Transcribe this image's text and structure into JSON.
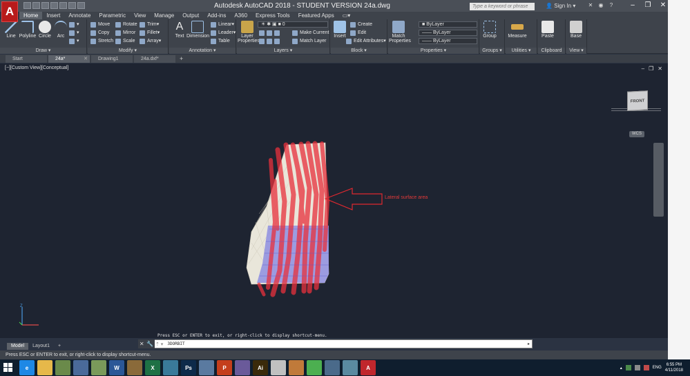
{
  "window": {
    "title": "Autodesk AutoCAD 2018 - STUDENT VERSION    24a.dwg",
    "search_placeholder": "Type a keyword or phrase",
    "signin": "Sign In",
    "logo": "A"
  },
  "ribbon_tabs": [
    "Home",
    "Insert",
    "Annotate",
    "Parametric",
    "View",
    "Manage",
    "Output",
    "Add-ins",
    "A360",
    "Express Tools",
    "Featured Apps"
  ],
  "ribbon": {
    "draw": {
      "title": "Draw",
      "line": "Line",
      "polyline": "Polyline",
      "circle": "Circle",
      "arc": "Arc"
    },
    "modify": {
      "title": "Modify",
      "move": "Move",
      "rotate": "Rotate",
      "trim": "Trim",
      "copy": "Copy",
      "mirror": "Mirror",
      "fillet": "Fillet",
      "stretch": "Stretch",
      "scale": "Scale",
      "array": "Array"
    },
    "annotation": {
      "title": "Annotation",
      "text": "Text",
      "dimension": "Dimension",
      "linear": "Linear",
      "leader": "Leader",
      "table": "Table"
    },
    "layers": {
      "title": "Layers",
      "layer_properties": "Layer Properties",
      "current_layer": "0",
      "make_current": "Make Current",
      "match_layer": "Match Layer"
    },
    "block": {
      "title": "Block",
      "insert": "Insert",
      "create": "Create",
      "edit": "Edit",
      "edit_attributes": "Edit Attributes"
    },
    "properties": {
      "title": "Properties",
      "match_properties": "Match Properties",
      "color": "ByLayer",
      "linetype": "ByLayer",
      "lineweight": "ByLayer"
    },
    "groups": {
      "title": "Groups",
      "group": "Group"
    },
    "utilities": {
      "title": "Utilities",
      "measure": "Measure"
    },
    "clipboard": {
      "title": "Clipboard",
      "paste": "Paste"
    },
    "view": {
      "title": "View",
      "base": "Base"
    }
  },
  "file_tabs": [
    {
      "label": "Start"
    },
    {
      "label": "24a*"
    },
    {
      "label": "Drawing1"
    },
    {
      "label": "24a.dxf*"
    }
  ],
  "viewport": {
    "label": "[−][Custom View][Conceptual]",
    "viewcube_face": "FRONT",
    "wcs": "WCS",
    "annotation": "Lateral surface area",
    "ucs_z": "Z"
  },
  "command": {
    "hint": "Press ESC or ENTER to exit, or right-click to display shortcut-menu.",
    "prompt": "3DORBIT"
  },
  "layout_tabs": [
    "Model",
    "Layout1"
  ],
  "status": "Press ESC or ENTER to exit, or right-click to display shortcut-menu.",
  "taskbar": {
    "apps": [
      {
        "name": "ie-icon",
        "label": "e",
        "color": "#1e88e5"
      },
      {
        "name": "explorer-icon",
        "label": "",
        "color": "#e6b84a"
      },
      {
        "name": "app3-icon",
        "label": "",
        "color": "#6a8a4a"
      },
      {
        "name": "app4-icon",
        "label": "",
        "color": "#4a6a9a"
      },
      {
        "name": "app5-icon",
        "label": "",
        "color": "#7a9a5a"
      },
      {
        "name": "word-icon",
        "label": "W",
        "color": "#2b5797"
      },
      {
        "name": "app7-icon",
        "label": "",
        "color": "#8a6a3a"
      },
      {
        "name": "excel-icon",
        "label": "X",
        "color": "#1e7145"
      },
      {
        "name": "app9-icon",
        "label": "",
        "color": "#3a7a9a"
      },
      {
        "name": "photoshop-icon",
        "label": "Ps",
        "color": "#0d2a4a"
      },
      {
        "name": "app11-icon",
        "label": "",
        "color": "#5a7aa0"
      },
      {
        "name": "powerpoint-icon",
        "label": "P",
        "color": "#c43e1c"
      },
      {
        "name": "app13-icon",
        "label": "",
        "color": "#6a5a9a"
      },
      {
        "name": "illustrator-icon",
        "label": "Ai",
        "color": "#3a2a0a"
      },
      {
        "name": "acrobat-icon",
        "label": "",
        "color": "#c0c0c0"
      },
      {
        "name": "app16-icon",
        "label": "",
        "color": "#c07a3a"
      },
      {
        "name": "chrome-icon",
        "label": "",
        "color": "#4caf50"
      },
      {
        "name": "app18-icon",
        "label": "",
        "color": "#4a6a8a"
      },
      {
        "name": "app19-icon",
        "label": "",
        "color": "#5a8aa0"
      },
      {
        "name": "autocad-icon",
        "label": "A",
        "color": "#c0272d"
      }
    ],
    "lang": "ENG",
    "time": "6:55 PM",
    "date": "4/11/2018"
  }
}
